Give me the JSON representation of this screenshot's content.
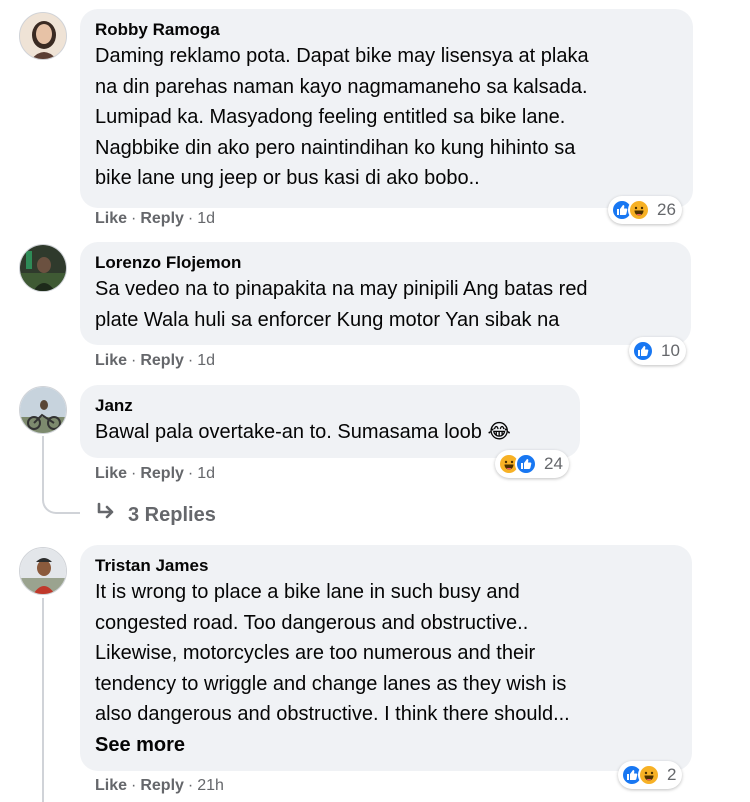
{
  "actions": {
    "like": "Like",
    "reply": "Reply",
    "separator": "·"
  },
  "colors": {
    "bubble": "#f0f2f5",
    "meta": "#65676b",
    "like_blue": "#1877f2",
    "haha_yellow": "#f7b125"
  },
  "comments": [
    {
      "author": "Robby Ramoga",
      "text": "Daming reklamo pota. Dapat bike may lisensya at plaka\nna din parehas naman kayo nagmamaneho sa kalsada.\nLumipad ka. Masyadong feeling entitled sa bike lane.\nNagbbike din ako pero naintindihan ko kung hihinto sa\nbike lane ung jeep or bus kasi di ako bobo..",
      "time": "1d",
      "reaction_count": "26",
      "reaction_icons": [
        "like-icon",
        "haha-icon"
      ]
    },
    {
      "author": "Lorenzo Flojemon",
      "text": "Sa vedeo na to pinapakita na may pinipili Ang batas red\nplate Wala huli sa enforcer Kung motor Yan sibak na",
      "time": "1d",
      "reaction_count": "10",
      "reaction_icons": [
        "like-icon"
      ]
    },
    {
      "author": "Janz",
      "text": "Bawal pala overtake-an to. Sumasama loob",
      "text_emoji": "😂",
      "time": "1d",
      "reaction_count": "24",
      "reaction_icons": [
        "haha-icon",
        "like-icon"
      ],
      "replies_label": "3 Replies"
    },
    {
      "author": "Tristan James",
      "text": "It is wrong to place a bike lane in such busy and\ncongested road. Too dangerous and obstructive..\nLikewise, motorcycles are too numerous and their\ntendency to wriggle and change lanes as they wish is\nalso dangerous and obstructive. I think there should...",
      "see_more": "See more",
      "time": "21h",
      "reaction_count": "2",
      "reaction_icons": [
        "like-icon",
        "haha-icon"
      ]
    }
  ]
}
